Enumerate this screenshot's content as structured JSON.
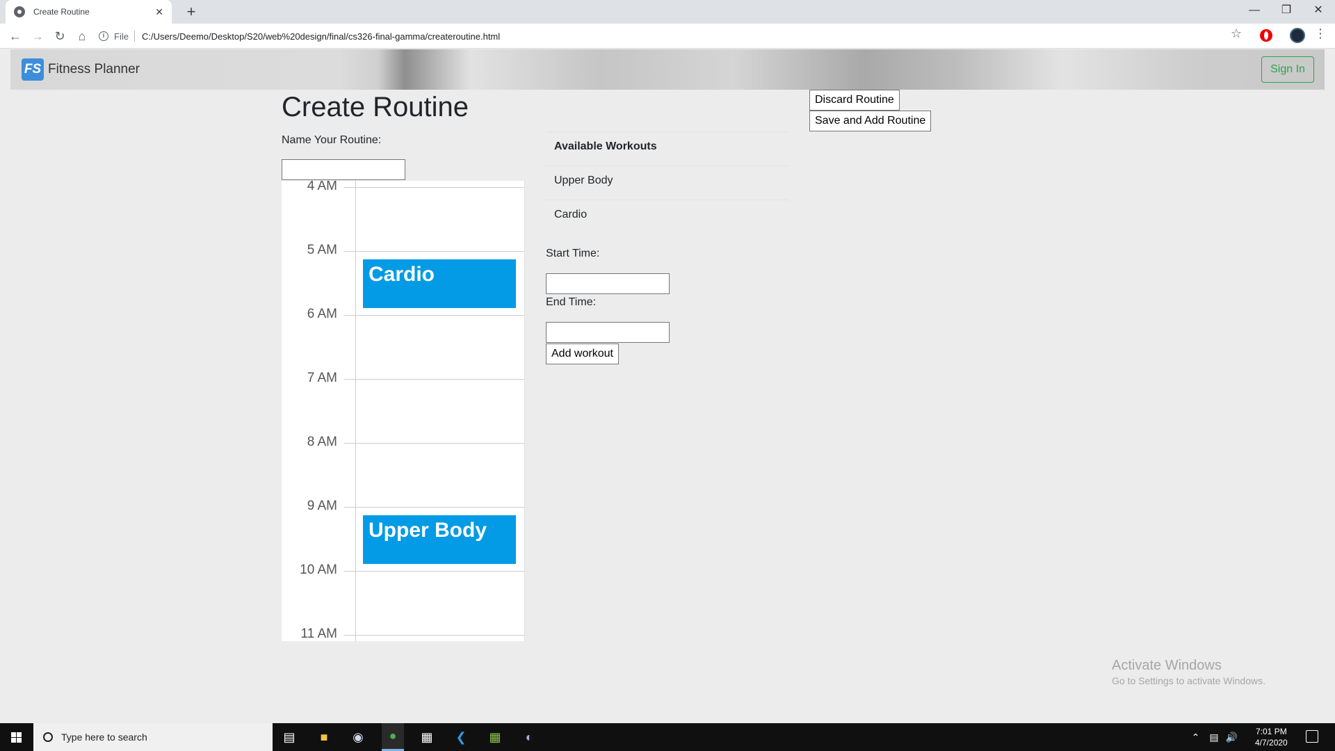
{
  "browser": {
    "tab_title": "Create Routine",
    "tab_close": "✕",
    "new_tab": "+",
    "address_info": "i",
    "address_file": "File",
    "address_url": "C:/Users/Deemo/Desktop/S20/web%20design/final/cs326-final-gamma/createroutine.html"
  },
  "site": {
    "brand_logo": "FS",
    "brand_name": "Fitness Planner",
    "signin_label": "Sign In"
  },
  "page": {
    "title": "Create Routine",
    "name_label": "Name Your Routine:",
    "name_value": "",
    "discard_label": "Discard Routine",
    "save_label": "Save and Add Routine"
  },
  "calendar": {
    "hours": [
      "4 AM",
      "5 AM",
      "6 AM",
      "7 AM",
      "8 AM",
      "9 AM",
      "10 AM",
      "11 AM"
    ],
    "events": [
      {
        "title": "Cardio",
        "start": "5 AM",
        "end": "6 AM"
      },
      {
        "title": "Upper Body",
        "start": "9 AM",
        "end": "10 AM"
      }
    ],
    "event_color": "#039be5"
  },
  "workouts": {
    "header": "Available Workouts",
    "items": [
      "Upper Body",
      "Cardio"
    ]
  },
  "form": {
    "start_label": "Start Time:",
    "start_value": "",
    "end_label": "End Time:",
    "end_value": "",
    "add_label": "Add workout"
  },
  "watermark": {
    "line1": "Activate Windows",
    "line2": "Go to Settings to activate Windows."
  },
  "taskbar": {
    "search_placeholder": "Type here to search",
    "time": "7:01 PM",
    "date": "4/7/2020"
  }
}
